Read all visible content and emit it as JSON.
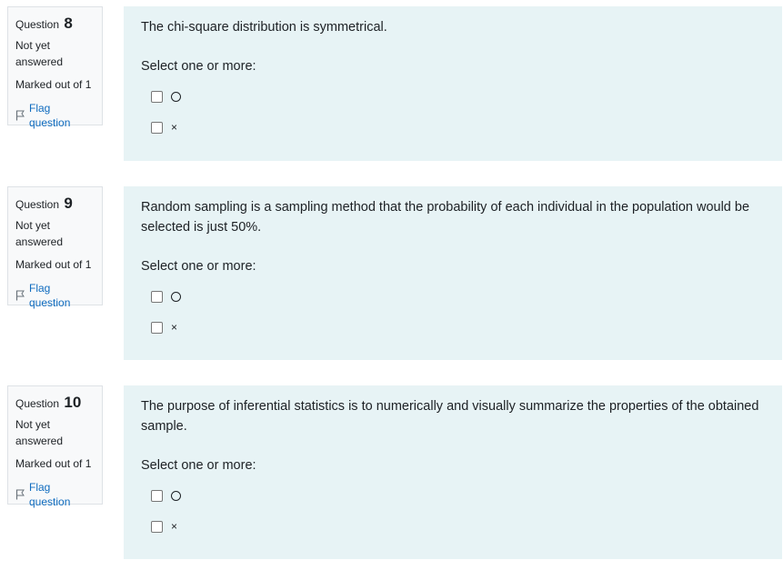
{
  "questions": [
    {
      "label": "Question",
      "number": "8",
      "state": "Not yet answered",
      "grade": "Marked out of 1",
      "flag_label": "Flag question",
      "text": "The chi-square distribution is symmetrical.",
      "prompt": "Select one or more:",
      "options": [
        {
          "symbol": "circle-icon",
          "checked": false
        },
        {
          "label": "×",
          "checked": false
        }
      ]
    },
    {
      "label": "Question",
      "number": "9",
      "state": "Not yet answered",
      "grade": "Marked out of 1",
      "flag_label": "Flag question",
      "text": "Random sampling is a sampling method that the probability of each individual in the population would be selected is just 50%.",
      "prompt": "Select one or more:",
      "options": [
        {
          "symbol": "circle-icon",
          "checked": false
        },
        {
          "label": "×",
          "checked": false
        }
      ]
    },
    {
      "label": "Question",
      "number": "10",
      "state": "Not yet answered",
      "grade": "Marked out of 1",
      "flag_label": "Flag question",
      "text": "The purpose of inferential statistics is to numerically and visually summarize the properties of the obtained sample.",
      "prompt": "Select one or more:",
      "options": [
        {
          "symbol": "circle-icon",
          "checked": false
        },
        {
          "label": "×",
          "checked": false
        }
      ]
    }
  ],
  "colors": {
    "content_bg": "#e7f3f5",
    "info_bg": "#f8f9fa",
    "link": "#0f6cbf"
  }
}
